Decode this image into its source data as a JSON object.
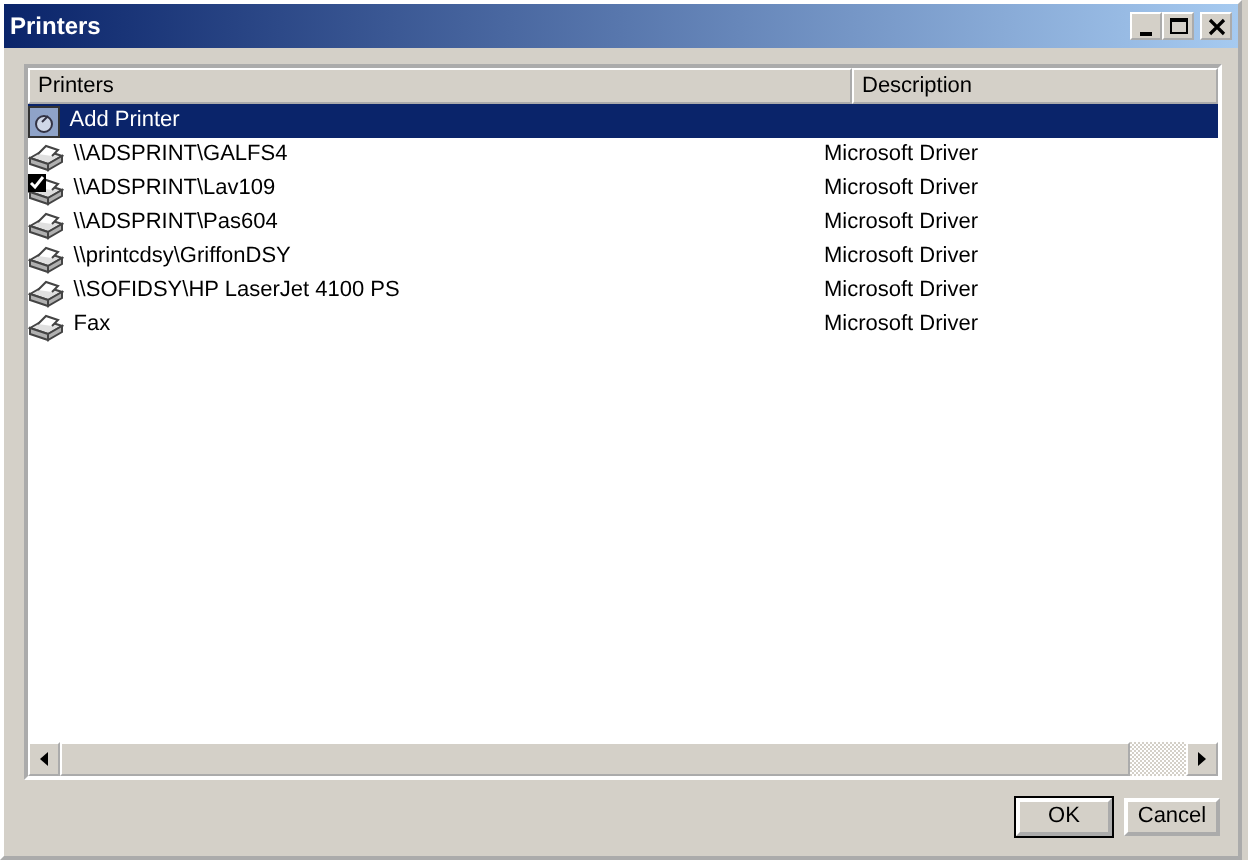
{
  "window": {
    "title": "Printers"
  },
  "columns": [
    "Printers",
    "Description"
  ],
  "rows": [
    {
      "kind": "add",
      "name": "Add Printer",
      "description": "",
      "selected": true
    },
    {
      "kind": "printer",
      "name": "\\\\ADSPRINT\\GALFS4",
      "description": "Microsoft Driver",
      "selected": false,
      "default": false
    },
    {
      "kind": "printer",
      "name": "\\\\ADSPRINT\\Lav109",
      "description": "Microsoft Driver",
      "selected": false,
      "default": true
    },
    {
      "kind": "printer",
      "name": "\\\\ADSPRINT\\Pas604",
      "description": "Microsoft Driver",
      "selected": false,
      "default": false
    },
    {
      "kind": "printer",
      "name": "\\\\printcdsy\\GriffonDSY",
      "description": "Microsoft Driver",
      "selected": false,
      "default": false
    },
    {
      "kind": "printer",
      "name": "\\\\SOFIDSY\\HP LaserJet 4100 PS",
      "description": "Microsoft Driver",
      "selected": false,
      "default": false
    },
    {
      "kind": "printer",
      "name": "Fax",
      "description": "Microsoft Driver",
      "selected": false,
      "default": false
    }
  ],
  "buttons": [
    "OK",
    "Cancel"
  ]
}
